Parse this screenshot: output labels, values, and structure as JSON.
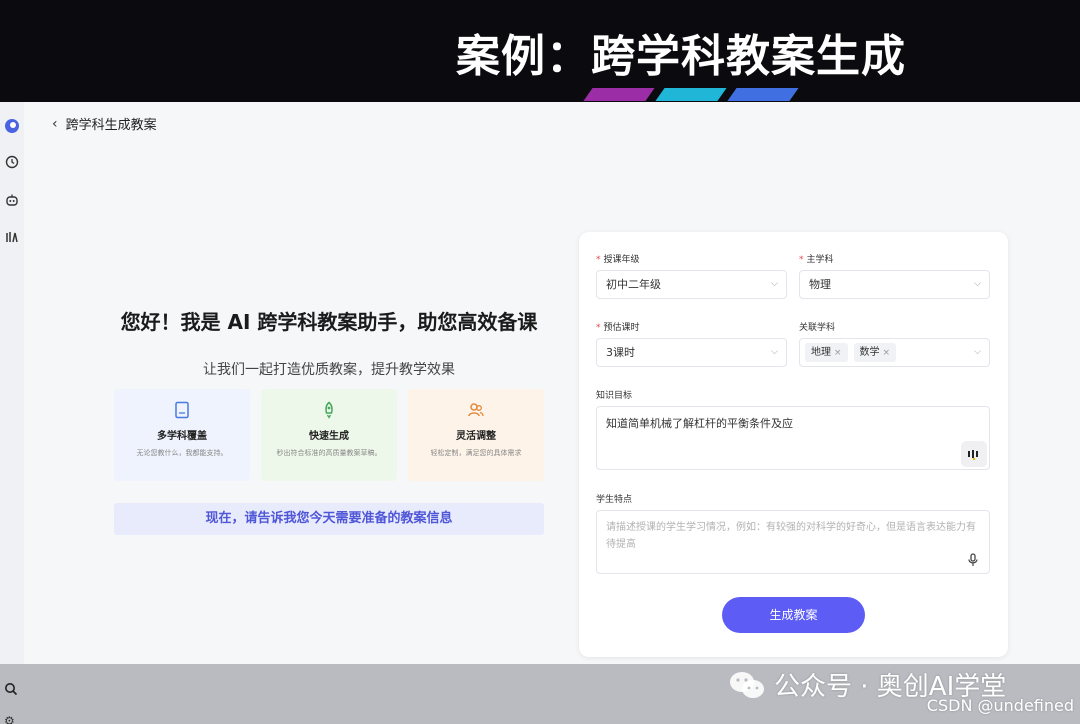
{
  "slide": {
    "title": "案例：跨学科教案生成",
    "stripe_colors": [
      "#9b2ea6",
      "#1fb6d8",
      "#3f6fe0"
    ]
  },
  "sidebar": {
    "icons": [
      "app-logo-icon",
      "history-icon",
      "robot-icon",
      "library-icon"
    ],
    "bottom_icons": [
      "search-icon",
      "settings-icon"
    ]
  },
  "header": {
    "back_label": "跨学科生成教案"
  },
  "welcome": {
    "greeting": "您好！我是 AI 跨学科教案助手，助您高效备课",
    "subtitle": "让我们一起打造优质教案，提升教学效果",
    "cards": [
      {
        "icon": "document-icon",
        "title": "多学科覆盖",
        "desc": "无论您教什么，我都能支持。"
      },
      {
        "icon": "rocket-icon",
        "title": "快速生成",
        "desc": "秒出符合标准的高质量教案草稿。"
      },
      {
        "icon": "users-icon",
        "title": "灵活调整",
        "desc": "轻松定制，满足您的具体需求"
      }
    ],
    "prompt": "现在，请告诉我您今天需要准备的教案信息"
  },
  "form": {
    "grade_label": "授课年级",
    "grade_value": "初中二年级",
    "subject_label": "主学科",
    "subject_value": "物理",
    "hours_label": "预估课时",
    "hours_value": "3课时",
    "related_label": "关联学科",
    "related_tags": [
      "地理",
      "数学"
    ],
    "knowledge_label": "知识目标",
    "knowledge_value": "知道简单机械了解杠杆的平衡条件及应",
    "student_label": "学生特点",
    "student_placeholder": "请描述授课的学生学习情况，例如：有较强的对科学的好奇心，但是语言表达能力有待提高",
    "submit_label": "生成教案"
  },
  "colors": {
    "accent": "#5d5df5",
    "required": "#e5484d",
    "prompt_text": "#4f56d8"
  },
  "watermark": {
    "wechat": "公众号 · 奥创AI学堂",
    "csdn": "CSDN @undefined"
  }
}
